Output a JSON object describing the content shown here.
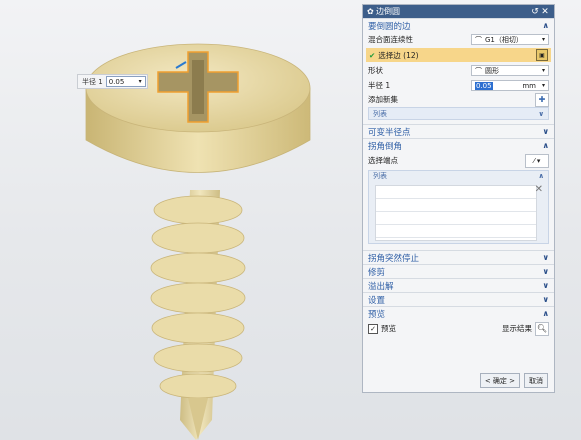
{
  "radius_popup": {
    "label": "半径 1",
    "value": "0.05"
  },
  "panel": {
    "title": "边倒圆",
    "sections": {
      "edges": {
        "title": "要倒圆的边",
        "continuity_label": "混合面连续性",
        "continuity_value": "G1（相切）",
        "select_edge": "选择边 (12)",
        "shape_label": "形状",
        "shape_value": "圆形",
        "radius_label": "半径 1",
        "radius_value": "0.05",
        "radius_unit": "mm",
        "add_set_label": "添加新集",
        "list_label": "列表"
      },
      "variable_radius": {
        "title": "可变半径点"
      },
      "corner_setback": {
        "title": "拐角倒角",
        "select_endpoint": "选择端点",
        "list_label": "列表"
      },
      "corner_stop": {
        "title": "拐角突然停止"
      },
      "trim": {
        "title": "修剪"
      },
      "overflow": {
        "title": "溢出解"
      },
      "settings": {
        "title": "设置"
      },
      "preview": {
        "title": "预览",
        "preview_checkbox": "预览",
        "show_result": "显示结果"
      }
    },
    "ok_label": "< 确定 >",
    "cancel_label": "取消"
  },
  "colors": {
    "title_bar": "#3d5e8a",
    "section_text": "#2f5fa6",
    "highlight_row": "#f7d68a",
    "screw_body": "#e9d9a0"
  }
}
